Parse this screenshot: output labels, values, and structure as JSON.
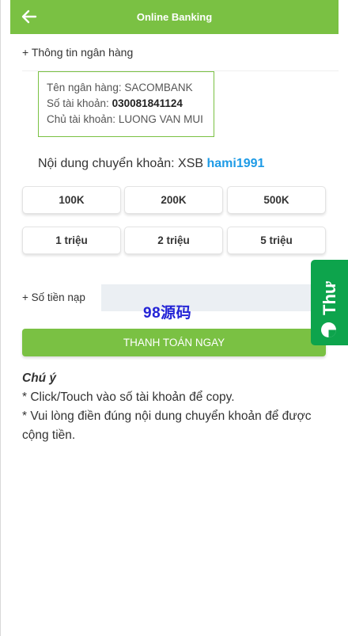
{
  "header": {
    "title": "Online Banking",
    "back_icon": "arrow-left-icon",
    "background": "#7ac143"
  },
  "bank_info": {
    "section_title": "+ Thông tin ngân hàng",
    "bank_name_label": "Tên ngân hàng:",
    "bank_name": "SACOMBANK",
    "account_number_label": "Số tài khoản:",
    "account_number": "030081841124",
    "account_holder_label": "Chủ tài khoản:",
    "account_holder": "LUONG VAN MUI"
  },
  "transfer": {
    "label": "Nội dung chuyển khoản:",
    "prefix": "XSB",
    "code": "hami1991",
    "code_color": "#1e9be6"
  },
  "amount_options": [
    "100K",
    "200K",
    "500K",
    "1 triệu",
    "2 triệu",
    "5 triệu"
  ],
  "amount_input": {
    "label": "+ Số tiền nạp",
    "value": "",
    "placeholder": ""
  },
  "watermark": "98源码",
  "pay_button": {
    "label": "THANH TOÁN NGAY"
  },
  "notes": {
    "title": "Chú ý",
    "lines": [
      "* Click/Touch vào số tài khoản để copy.",
      "* Vui lòng điền đúng nội dung chuyển khoản để được cộng tiền."
    ]
  },
  "side_tab": {
    "label": "Thư",
    "icon": "chat-bubble-icon",
    "color": "#0da44c"
  }
}
